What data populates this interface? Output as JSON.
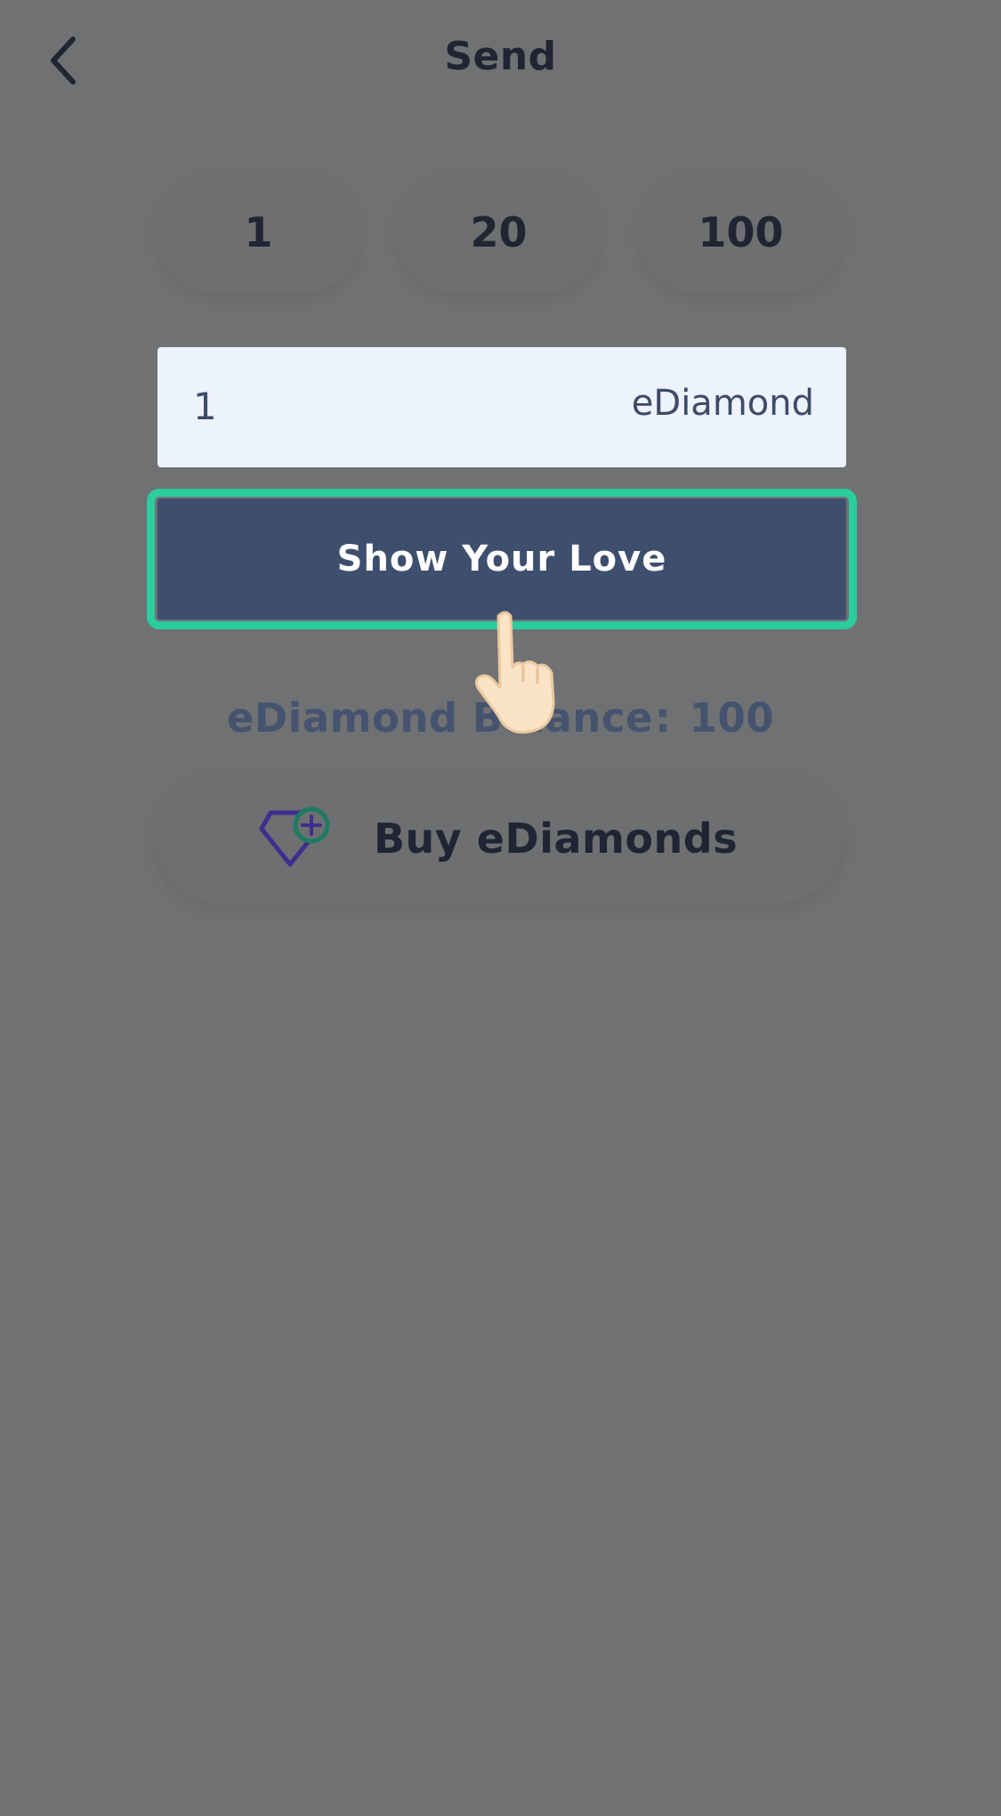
{
  "header": {
    "title": "Send",
    "back_icon": "chevron-left-icon"
  },
  "quick_amounts": [
    "1",
    "20",
    "100"
  ],
  "amount_input": {
    "value": "1",
    "unit": "eDiamond"
  },
  "primary_button": {
    "label": "Show Your Love",
    "highlighted": true
  },
  "balance": {
    "label": "eDiamond Balance",
    "separator": ":",
    "value": "100"
  },
  "buy_button": {
    "label": "Buy eDiamonds",
    "icon": "diamond-plus-icon"
  },
  "overlay": {
    "pointer_icon": "tap-hand-icon"
  },
  "colors": {
    "background": "#707173",
    "input_bg": "#edf3fd",
    "primary_button": "#3e4f6e",
    "highlight": "#2bcc9e",
    "diamond_icon": "#3c2f8f",
    "plus_circle": "#1e7a64"
  }
}
